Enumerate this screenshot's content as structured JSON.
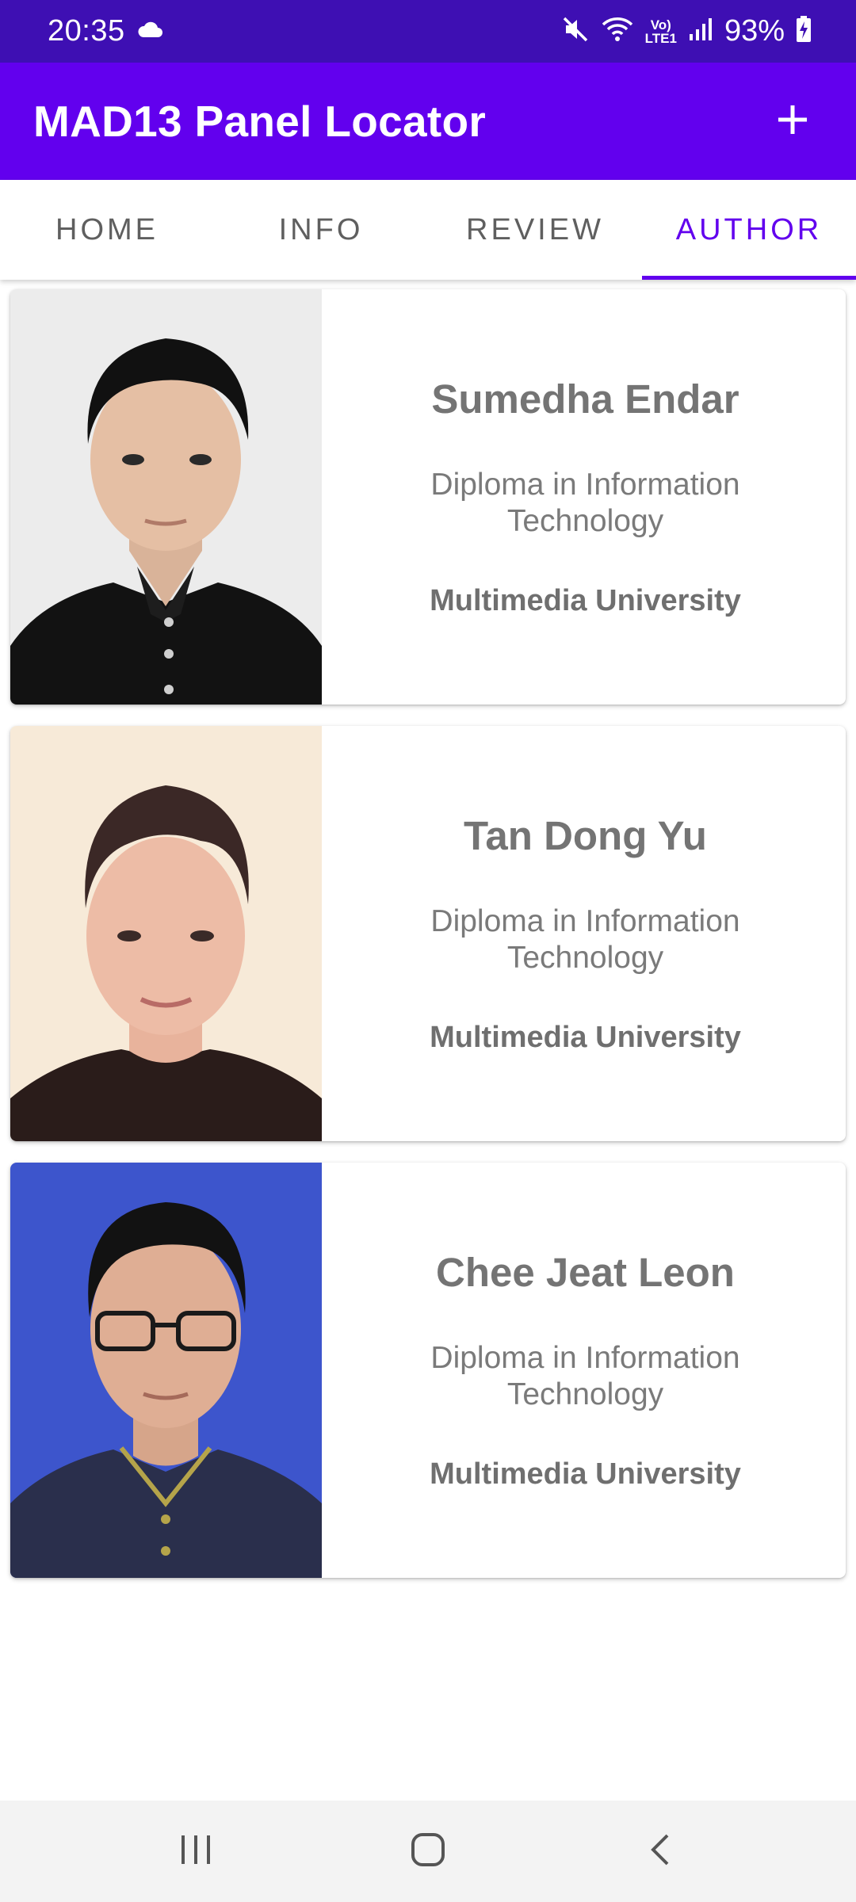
{
  "status_bar": {
    "time": "20:35",
    "network": [
      "Vo)",
      "LTE1"
    ],
    "battery_percent": "93%",
    "icons": [
      "cloud-icon",
      "mute-icon",
      "wifi-icon",
      "signal-icon",
      "battery-charging-icon"
    ]
  },
  "app_bar": {
    "title": "MAD13 Panel Locator",
    "action_icon": "plus-icon"
  },
  "tabs": [
    {
      "label": "HOME",
      "active": false
    },
    {
      "label": "INFO",
      "active": false
    },
    {
      "label": "REVIEW",
      "active": false
    },
    {
      "label": "AUTHOR",
      "active": true
    }
  ],
  "authors": [
    {
      "name": "Sumedha Endar",
      "course": "Diploma in Information Technology",
      "university": "Multimedia University",
      "photo_background": "#ececec"
    },
    {
      "name": "Tan Dong Yu",
      "course": "Diploma in Information Technology",
      "university": "Multimedia University",
      "photo_background": "#f7ead8"
    },
    {
      "name": "Chee Jeat Leon",
      "course": "Diploma in Information Technology",
      "university": "Multimedia University",
      "photo_background": "#3d55cc"
    }
  ],
  "nav_bar": {
    "icons": [
      "recent-apps-icon",
      "home-icon",
      "back-icon"
    ]
  },
  "colors": {
    "status_bar": "#3e0fb3",
    "primary": "#6200ee",
    "text_secondary": "#747474"
  }
}
